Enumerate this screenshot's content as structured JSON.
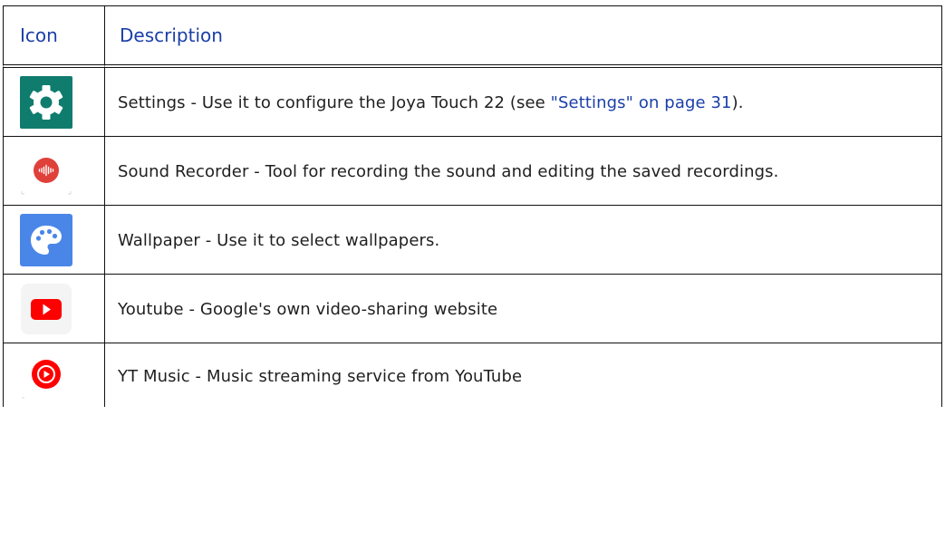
{
  "table": {
    "headers": {
      "icon": "Icon",
      "description": "Description"
    },
    "rows": [
      {
        "icon": "settings-gear-icon",
        "text_before": "Settings - Use it to configure the Joya Touch 22 (see ",
        "link": "\"Settings\" on page 31",
        "text_after": ")."
      },
      {
        "icon": "sound-recorder-icon",
        "text_before": "Sound Recorder - Tool for recording the sound and editing the saved recordings.",
        "link": "",
        "text_after": ""
      },
      {
        "icon": "wallpaper-palette-icon",
        "text_before": "Wallpaper - Use it to select wallpapers.",
        "link": "",
        "text_after": ""
      },
      {
        "icon": "youtube-play-icon",
        "text_before": "Youtube - Google's own video-sharing website",
        "link": "",
        "text_after": ""
      },
      {
        "icon": "yt-music-icon",
        "text_before": "YT Music - Music streaming service from YouTube",
        "link": "",
        "text_after": ""
      }
    ]
  },
  "colors": {
    "header_text": "#1b3fa8",
    "link_text": "#1b3fa8",
    "settings_bg": "#0f7c6e",
    "recorder_red": "#e0403a",
    "wallpaper_blue": "#4a86e8",
    "youtube_red": "#ff0000",
    "ytmusic_red": "#ff0000"
  }
}
